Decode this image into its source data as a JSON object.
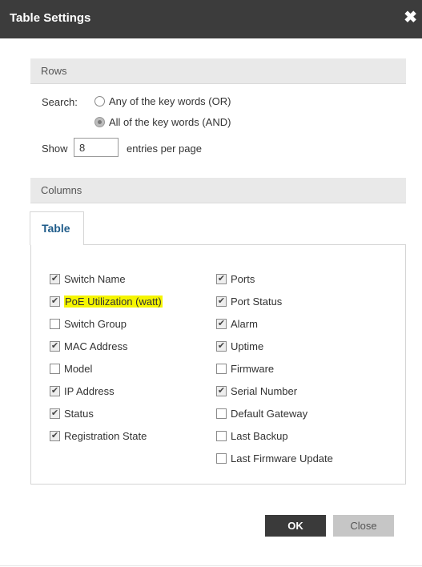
{
  "dialog": {
    "title": "Table Settings",
    "close_glyph": "✖"
  },
  "rows": {
    "header": "Rows",
    "search_label": "Search:",
    "options": [
      {
        "label": "Any of the key words (OR)",
        "selected": false
      },
      {
        "label": "All of the key words (AND)",
        "selected": true
      }
    ],
    "show_label": "Show",
    "entries_value": "8",
    "entries_suffix": "entries per page"
  },
  "columns": {
    "header": "Columns",
    "tab_label": "Table",
    "left": [
      {
        "label": "Switch Name",
        "checked": true
      },
      {
        "label": "PoE Utilization (watt)",
        "checked": true,
        "highlighted": true
      },
      {
        "label": "Switch Group",
        "checked": false
      },
      {
        "label": "MAC Address",
        "checked": true
      },
      {
        "label": "Model",
        "checked": false
      },
      {
        "label": "IP Address",
        "checked": true
      },
      {
        "label": "Status",
        "checked": true
      },
      {
        "label": "Registration State",
        "checked": true
      }
    ],
    "right": [
      {
        "label": "Ports",
        "checked": true
      },
      {
        "label": "Port Status",
        "checked": true
      },
      {
        "label": "Alarm",
        "checked": true
      },
      {
        "label": "Uptime",
        "checked": true
      },
      {
        "label": "Firmware",
        "checked": false
      },
      {
        "label": "Serial Number",
        "checked": true
      },
      {
        "label": "Default Gateway",
        "checked": false
      },
      {
        "label": "Last Backup",
        "checked": false
      },
      {
        "label": "Last Firmware Update",
        "checked": false
      }
    ]
  },
  "buttons": {
    "ok": "OK",
    "close": "Close"
  },
  "colors": {
    "titlebar": "#3c3c3c",
    "tab_text": "#1f5c8a",
    "highlight": "#f5f500",
    "ok_button": "#3a3a3a",
    "close_button": "#c6c6c6"
  }
}
